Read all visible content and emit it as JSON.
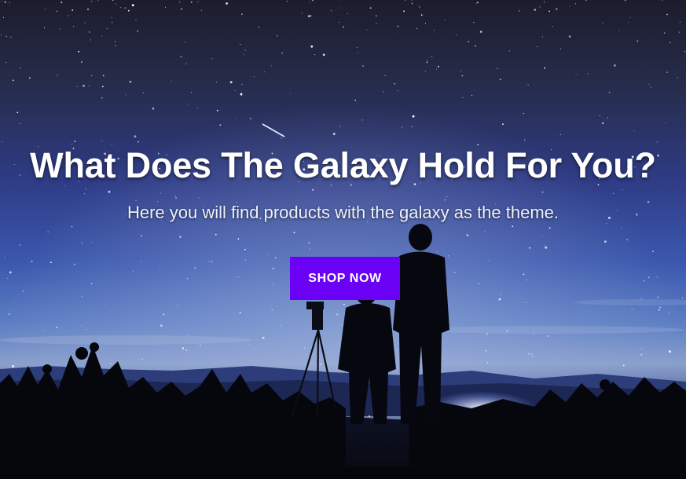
{
  "hero": {
    "title": "What Does The Galaxy Hold For You?",
    "subtitle": "Here you will find products with the galaxy as the theme.",
    "cta_label": "SHOP NOW",
    "background_image": "night-sky-stargazers-photo",
    "accent_color": "#6a00f4"
  }
}
